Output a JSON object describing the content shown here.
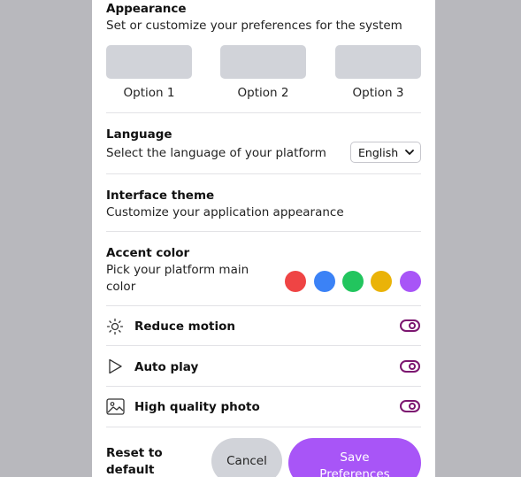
{
  "appearance": {
    "title": "Appearance",
    "description": "Set or customize your preferences for the system",
    "options": [
      "Option 1",
      "Option 2",
      "Option 3"
    ]
  },
  "language": {
    "title": "Language",
    "description": "Select the language of your platform",
    "selected": "English"
  },
  "interface_theme": {
    "title": "Interface theme",
    "description": "Customize your application appearance"
  },
  "accent_color": {
    "title": "Accent color",
    "description_line1": "Pick your platform main",
    "description_line2": "color",
    "colors": [
      "#ef4444",
      "#3b82f6",
      "#22c55e",
      "#eab308",
      "#a855f7"
    ]
  },
  "toggles": [
    {
      "label": "Reduce motion",
      "icon": "sun-icon",
      "on": true
    },
    {
      "label": "Auto play",
      "icon": "play-icon",
      "on": true
    },
    {
      "label": "High quality photo",
      "icon": "image-icon",
      "on": true
    }
  ],
  "footer": {
    "reset_line1": "Reset to",
    "reset_line2": "default",
    "cancel_label": "Cancel",
    "save_line1": "Save",
    "save_line2": "Preferences"
  },
  "colors": {
    "toggle": "#7c1670",
    "primary": "#a855f7",
    "option_bg": "#d1d3d9"
  }
}
